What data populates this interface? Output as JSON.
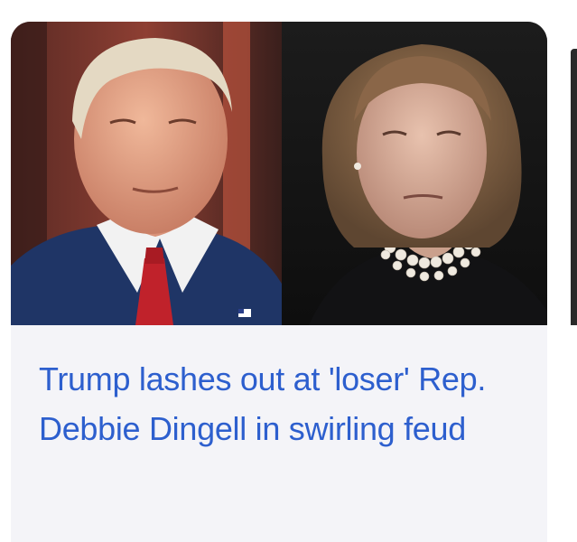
{
  "news_card": {
    "headline": "Trump lashes out at 'loser' Rep. Debbie Dingell in swirling feud",
    "thumbnail_subject": "trump-and-dingell-photo"
  },
  "colors": {
    "headline_link": "#2d5fce",
    "card_background": "#f4f4f8",
    "page_background": "#ffffff"
  }
}
